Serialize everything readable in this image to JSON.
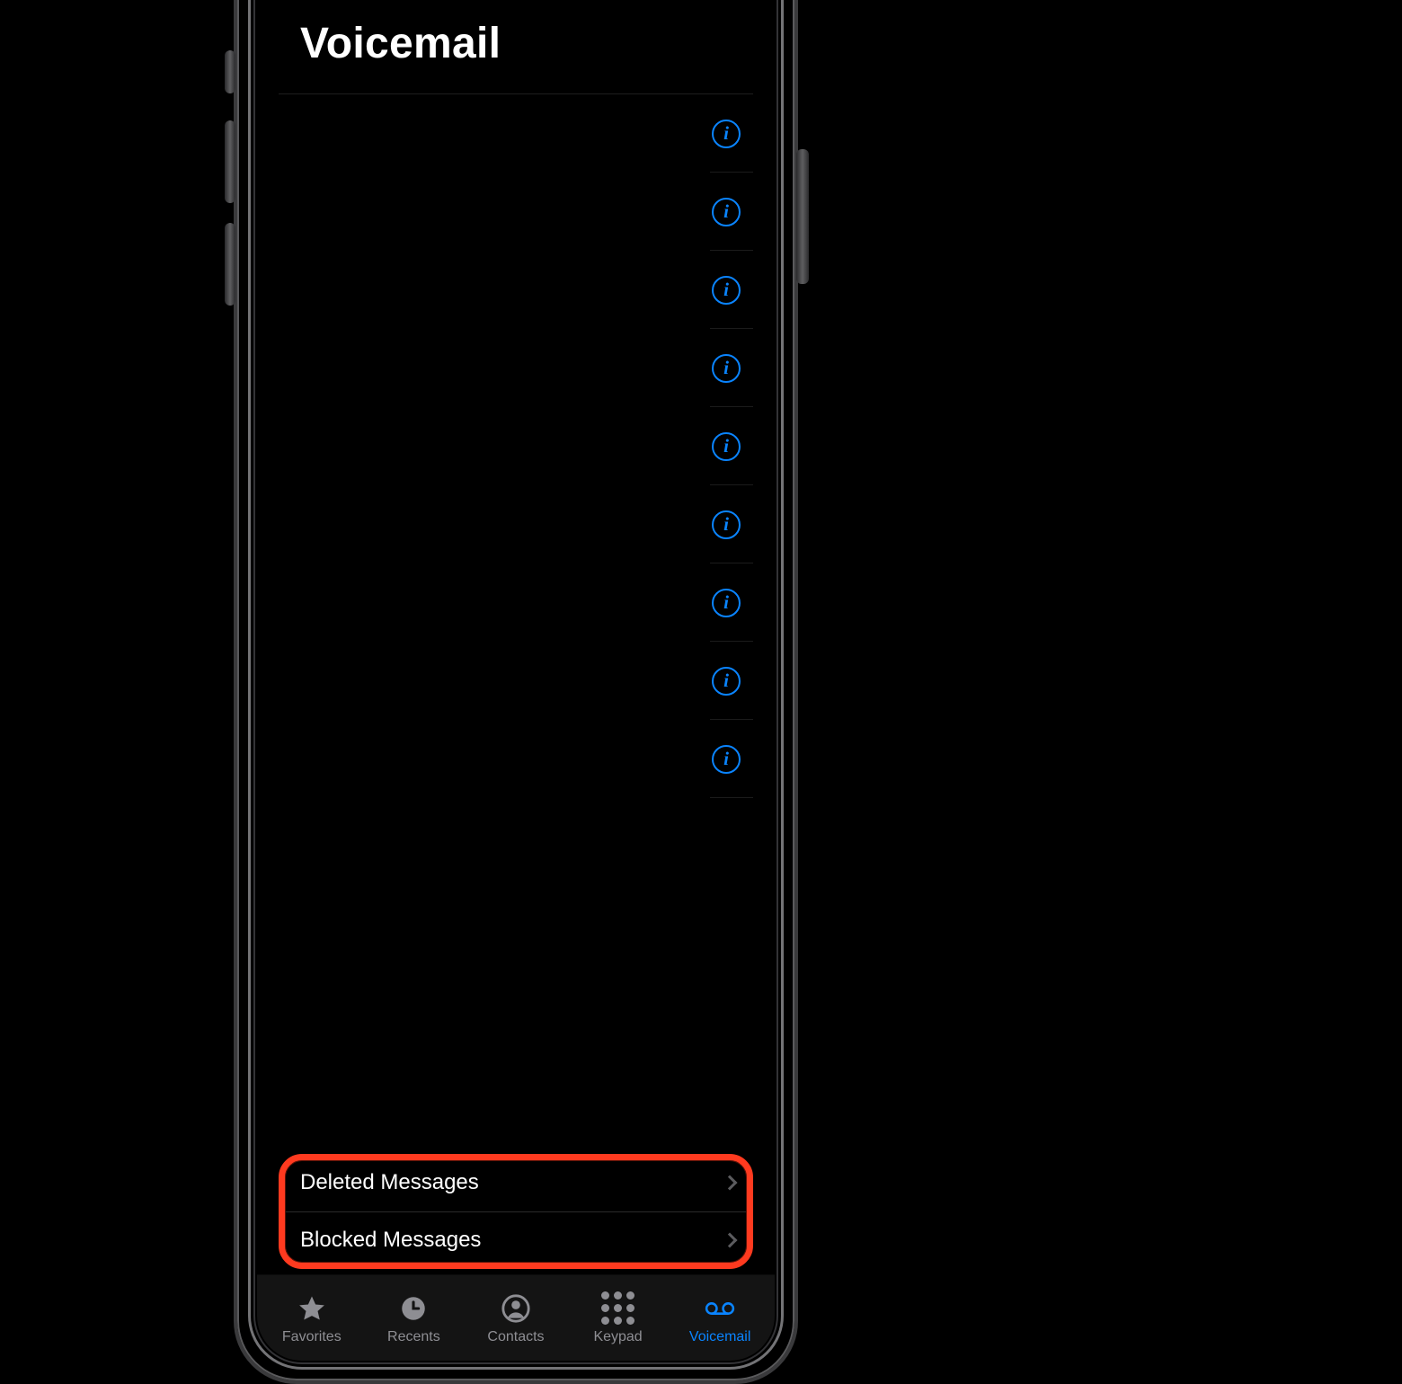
{
  "header": {
    "title": "Voicemail"
  },
  "voicemails": [
    {},
    {},
    {},
    {},
    {},
    {},
    {},
    {},
    {}
  ],
  "actions": {
    "deleted": "Deleted Messages",
    "blocked": "Blocked Messages"
  },
  "tabs": {
    "favorites": "Favorites",
    "recents": "Recents",
    "contacts": "Contacts",
    "keypad": "Keypad",
    "voicemail": "Voicemail",
    "active": "voicemail"
  },
  "colors": {
    "accent": "#0a84ff",
    "highlight": "#ff3a1f"
  }
}
